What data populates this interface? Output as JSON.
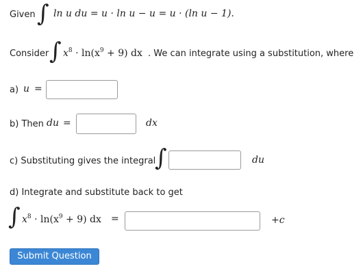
{
  "given": {
    "label": "Given",
    "expr": "ln u du = u · ln u − u = u · (ln u − 1)."
  },
  "consider": {
    "label": "Consider",
    "integrand": "x",
    "integrand_exp": "8",
    "integrand_rest": " · ln(x",
    "integrand_exp2": "9",
    "integrand_tail": " + 9) dx",
    "text": ". We can integrate using a substitution, where"
  },
  "part_a": {
    "label": "a)",
    "var": "u",
    "eq": "=",
    "value": ""
  },
  "part_b": {
    "label": "b) Then",
    "var": "du",
    "eq": "=",
    "value": "",
    "suffix": "dx"
  },
  "part_c": {
    "label": "c) Substituting gives the integral",
    "value": "",
    "suffix": "du"
  },
  "part_d": {
    "label": "d) Integrate and substitute back to get",
    "integrand": "x",
    "integrand_exp": "8",
    "integrand_rest": " · ln(x",
    "integrand_exp2": "9",
    "integrand_tail": " + 9) dx",
    "eq": "=",
    "value": "",
    "suffix": "+c"
  },
  "submit_label": "Submit Question"
}
